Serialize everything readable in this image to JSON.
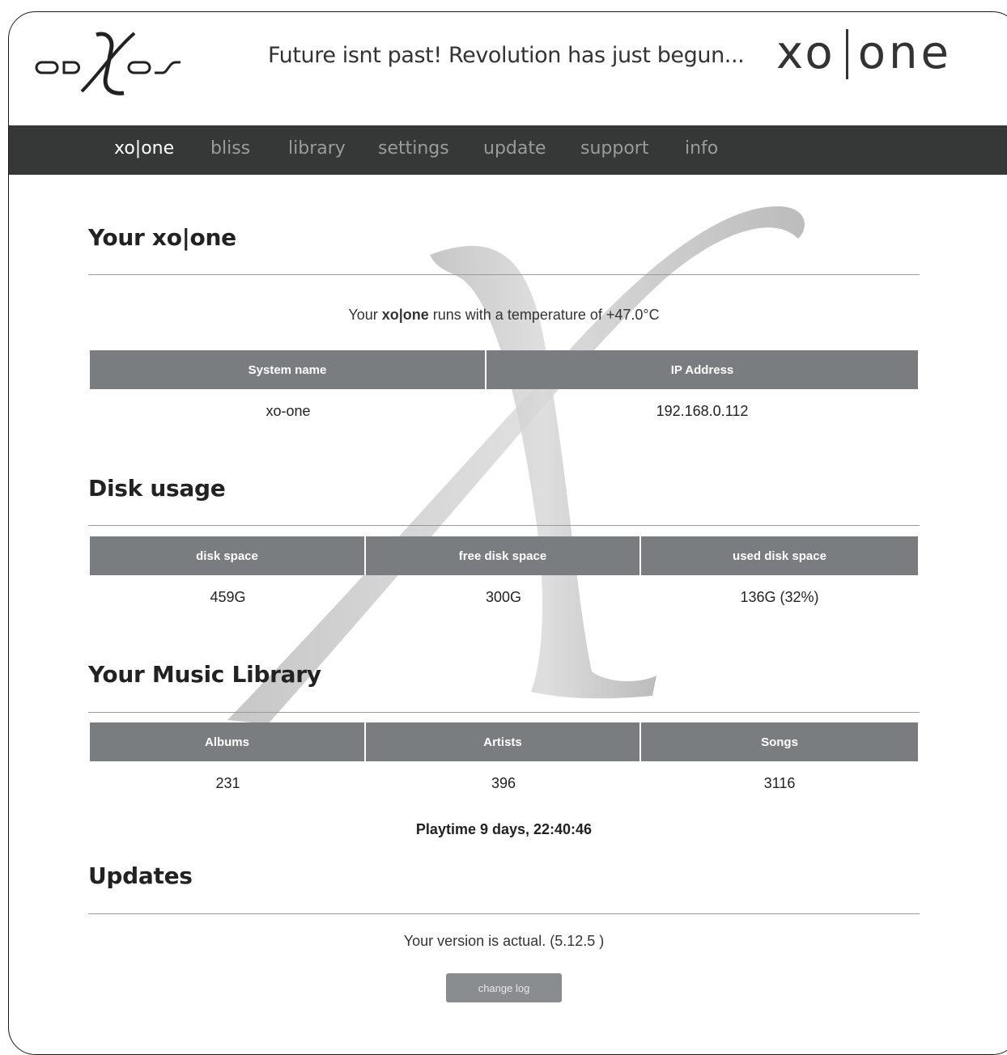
{
  "header": {
    "tagline": "Future isnt past! Revolution has just begun...",
    "brand_left": "xo",
    "brand_right": "one",
    "logo_name": "odXos"
  },
  "nav": {
    "items": [
      {
        "label": "xo|one",
        "active": true
      },
      {
        "label": "bliss"
      },
      {
        "label": "library"
      },
      {
        "label": "settings"
      },
      {
        "label": "update"
      },
      {
        "label": "support"
      },
      {
        "label": "info"
      }
    ]
  },
  "system": {
    "title": "Your xo|one",
    "temp_prefix": "Your ",
    "temp_brand": "xo|one",
    "temp_suffix": " runs with a temperature of +47.0°C",
    "headers": [
      "System name",
      "IP Address"
    ],
    "values": [
      "xo-one",
      "192.168.0.112"
    ]
  },
  "disk": {
    "title": "Disk usage",
    "headers": [
      "disk space",
      "free disk space",
      "used disk space"
    ],
    "values": [
      "459G",
      "300G",
      "136G (32%)"
    ]
  },
  "library": {
    "title": "Your Music Library",
    "headers": [
      "Albums",
      "Artists",
      "Songs"
    ],
    "values": [
      "231",
      "396",
      "3116"
    ],
    "playtime": "Playtime 9 days, 22:40:46"
  },
  "updates": {
    "title": "Updates",
    "status": "Your version is actual. (5.12.5 )",
    "button": "change log"
  },
  "colors": {
    "nav_bg": "#363838",
    "table_header_bg": "#7a7d7f",
    "button_bg": "#8a8d8f"
  }
}
